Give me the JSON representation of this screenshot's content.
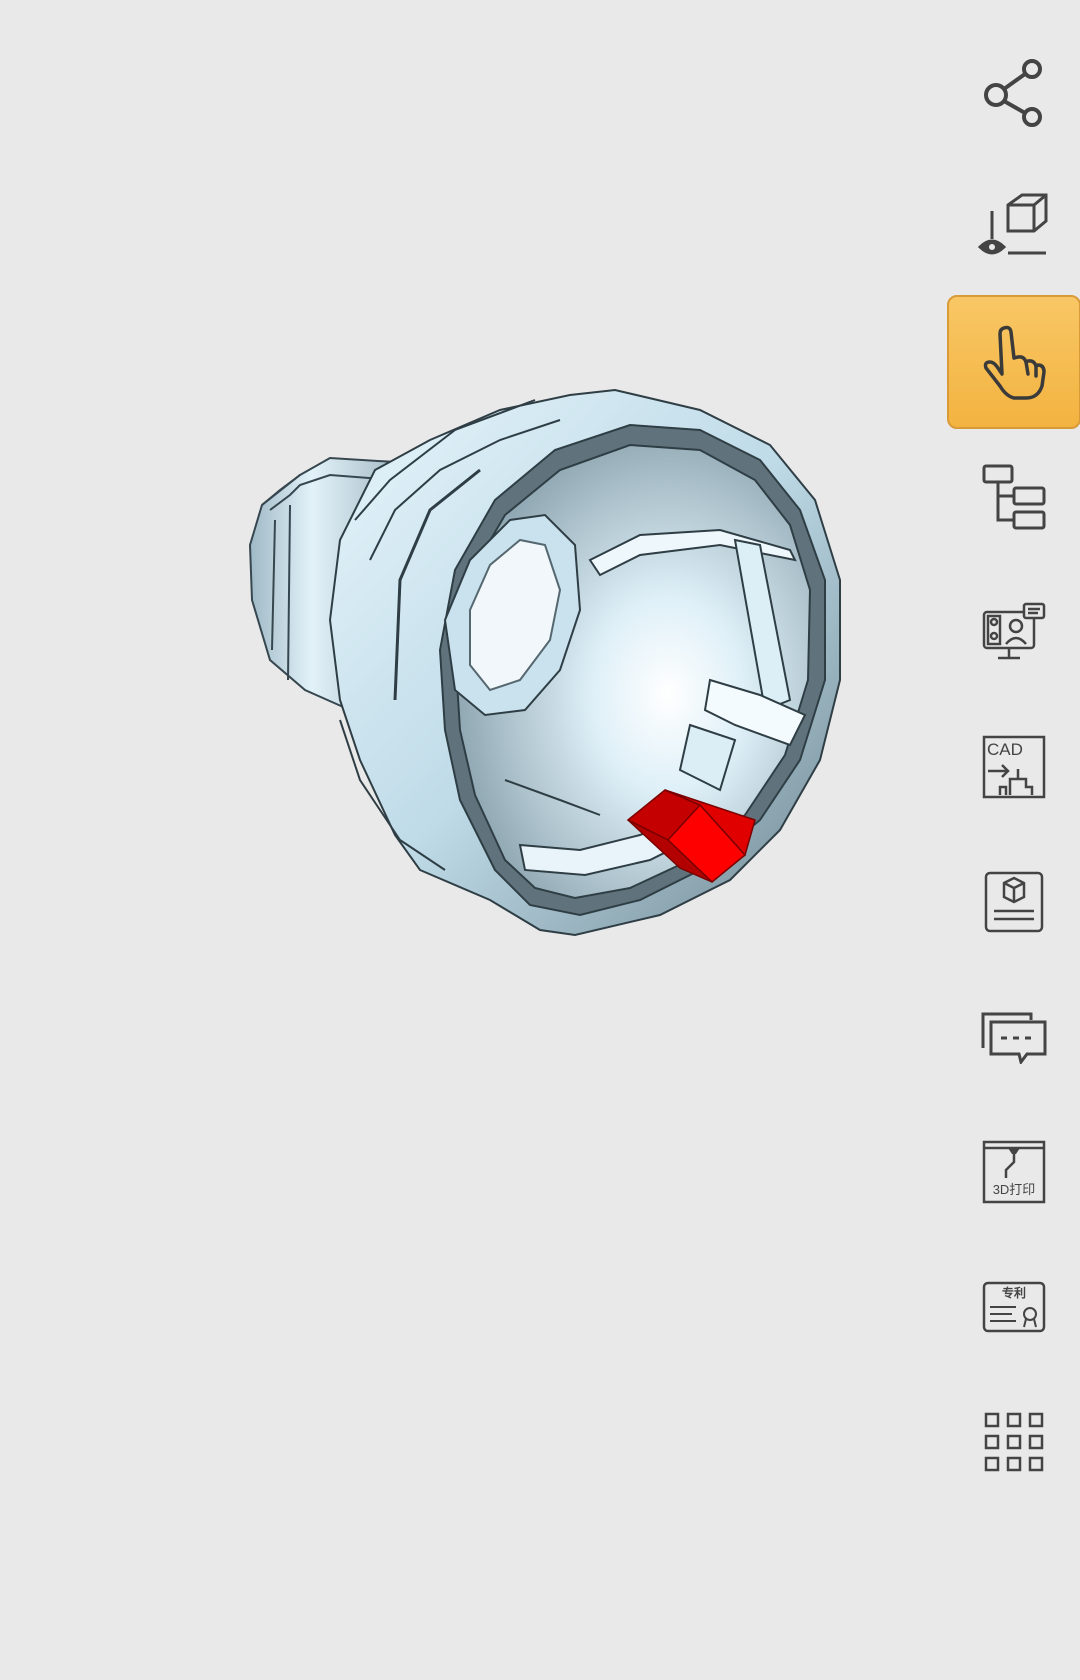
{
  "viewer": {
    "highlight_color": "#ff0000",
    "body_color": "#cfe8f3",
    "active_tool_color": "#f5b94f"
  },
  "toolbar": {
    "items": [
      {
        "icon": "share-icon",
        "label": ""
      },
      {
        "icon": "view-cube-eye-icon",
        "label": ""
      },
      {
        "icon": "hand-gesture-icon",
        "label": "",
        "active": true
      },
      {
        "icon": "model-tree-icon",
        "label": ""
      },
      {
        "icon": "video-meeting-icon",
        "label": ""
      },
      {
        "icon": "cad-to-drawing-icon",
        "label": "CAD"
      },
      {
        "icon": "model-document-icon",
        "label": ""
      },
      {
        "icon": "comments-icon",
        "label": ""
      },
      {
        "icon": "3d-print-icon",
        "label": "3D打印"
      },
      {
        "icon": "patent-certificate-icon",
        "label": "专利"
      },
      {
        "icon": "more-apps-grid-icon",
        "label": ""
      }
    ]
  }
}
